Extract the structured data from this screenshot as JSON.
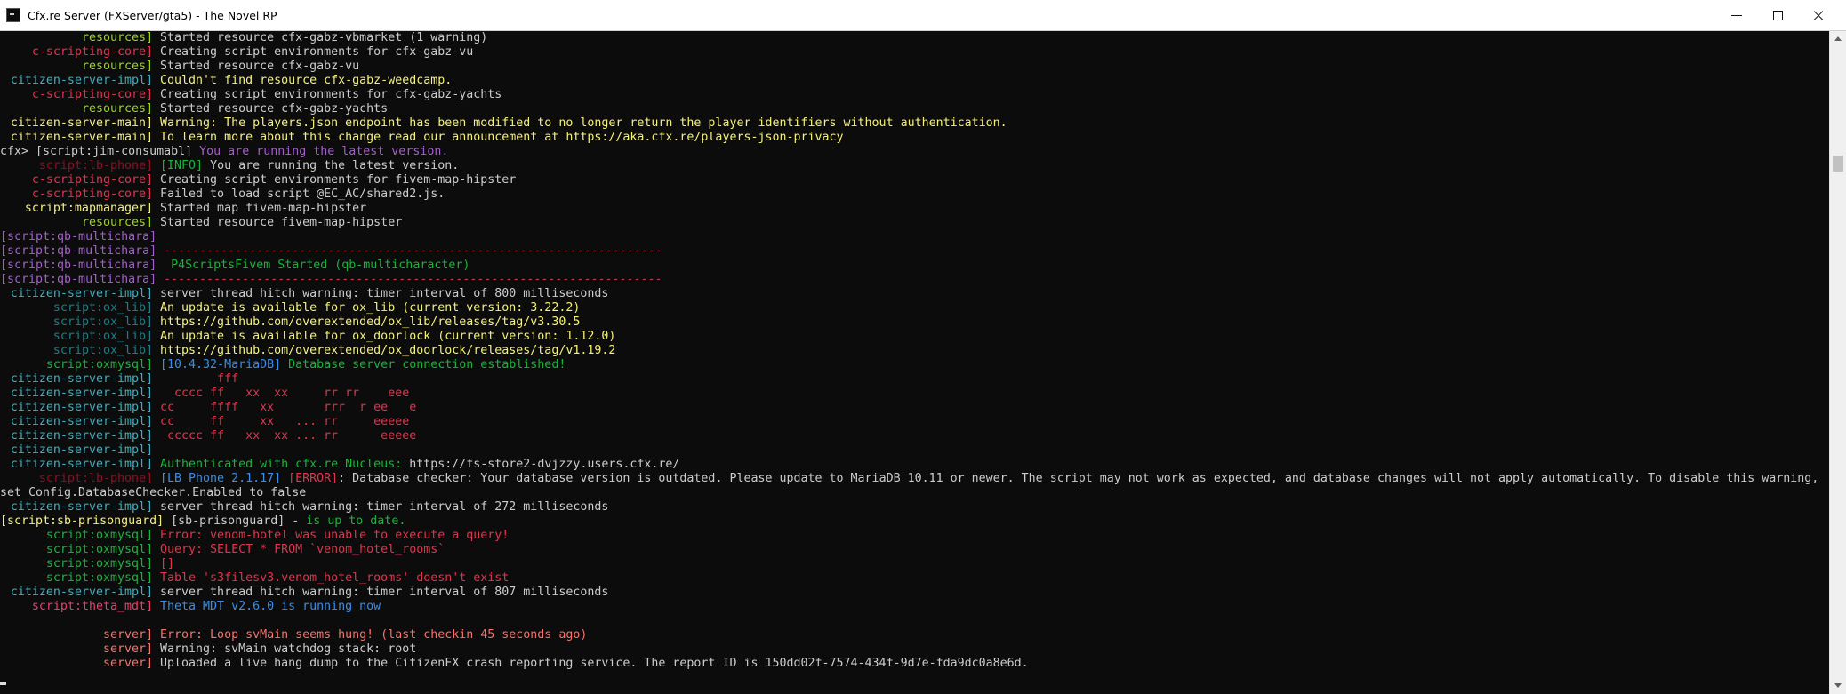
{
  "window": {
    "title": "Cfx.re Server (FXServer/gta5) - The Novel RP"
  },
  "icons": {
    "app": "cfx-server-icon",
    "minimize": "minimize-icon",
    "maximize": "maximize-icon",
    "close": "close-icon"
  },
  "colors": {
    "background": "#0c0c0c",
    "default_text": "#cccccc",
    "lime": "#9dd51b",
    "red": "#e0334e",
    "teal": "#3ab0c0",
    "yellow": "#f5f17a",
    "purple": "#a45fcc",
    "maroon": "#8d1024",
    "green": "#19b43a",
    "blue": "#3a8ee6",
    "dark_teal": "#197f8a",
    "salmon": "#f5736c",
    "pink": "#ef3c70"
  },
  "console": {
    "lines": [
      {
        "src": "resources]",
        "src_color": "lime",
        "segments": [
          {
            "text": "Started resource cfx-gabz-vbmarket (1 warning)",
            "color": "white"
          }
        ]
      },
      {
        "src": "c-scripting-core]",
        "src_color": "red",
        "segments": [
          {
            "text": "Creating script environments for cfx-gabz-vu",
            "color": "white"
          }
        ]
      },
      {
        "src": "resources]",
        "src_color": "lime",
        "segments": [
          {
            "text": "Started resource cfx-gabz-vu",
            "color": "white"
          }
        ]
      },
      {
        "src": "citizen-server-impl]",
        "src_color": "teal",
        "segments": [
          {
            "text": "Couldn't find resource cfx-gabz-weedcamp.",
            "color": "yellow"
          }
        ]
      },
      {
        "src": "c-scripting-core]",
        "src_color": "red",
        "segments": [
          {
            "text": "Creating script environments for cfx-gabz-yachts",
            "color": "white"
          }
        ]
      },
      {
        "src": "resources]",
        "src_color": "lime",
        "segments": [
          {
            "text": "Started resource cfx-gabz-yachts",
            "color": "white"
          }
        ]
      },
      {
        "src": "citizen-server-main]",
        "src_color": "yellow",
        "segments": [
          {
            "text": "Warning: The players.json endpoint has been modified to no longer return the player identifiers without authentication.",
            "color": "yellow"
          }
        ]
      },
      {
        "src": "citizen-server-main]",
        "src_color": "yellow",
        "segments": [
          {
            "text": "To learn more about this change read our announcement at https://aka.cfx.re/players-json-privacy",
            "color": "yellow"
          }
        ]
      },
      {
        "raw": true,
        "segments": [
          {
            "text": "cfx> [script:jim-consumabl] ",
            "color": "white"
          },
          {
            "text": "You are running the latest version.",
            "color": "purple"
          }
        ]
      },
      {
        "src": "script:lb-phone]",
        "src_color": "maroon",
        "segments": [
          {
            "text": "[INFO]",
            "color": "green"
          },
          {
            "text": " You are running the latest version.",
            "color": "white"
          }
        ]
      },
      {
        "src": "c-scripting-core]",
        "src_color": "red",
        "segments": [
          {
            "text": "Creating script environments for fivem-map-hipster",
            "color": "white"
          }
        ]
      },
      {
        "src": "c-scripting-core]",
        "src_color": "red",
        "segments": [
          {
            "text": "Failed to load script @EC_AC/shared2.js.",
            "color": "white"
          }
        ]
      },
      {
        "src": "script:mapmanager]",
        "src_color": "yellow",
        "segments": [
          {
            "text": "Started map fivem-map-hipster",
            "color": "white"
          }
        ]
      },
      {
        "src": "resources]",
        "src_color": "lime",
        "segments": [
          {
            "text": "Started resource fivem-map-hipster",
            "color": "white"
          }
        ]
      },
      {
        "raw": true,
        "segments": [
          {
            "text": "[script:qb-multichara]",
            "color": "purple"
          }
        ]
      },
      {
        "raw": true,
        "segments": [
          {
            "text": "[script:qb-multichara] ",
            "color": "purple"
          },
          {
            "text": "----------------------------------------------------------------------",
            "color": "red"
          }
        ]
      },
      {
        "raw": true,
        "segments": [
          {
            "text": "[script:qb-multichara] ",
            "color": "purple"
          },
          {
            "text": " P4ScriptsFivem Started (qb-multicharacter)",
            "color": "green"
          }
        ]
      },
      {
        "raw": true,
        "segments": [
          {
            "text": "[script:qb-multichara] ",
            "color": "purple"
          },
          {
            "text": "----------------------------------------------------------------------",
            "color": "red"
          }
        ]
      },
      {
        "src": "citizen-server-impl]",
        "src_color": "teal",
        "segments": [
          {
            "text": "server thread hitch warning: timer interval of 800 milliseconds",
            "color": "white"
          }
        ]
      },
      {
        "src": "script:ox_lib]",
        "src_color": "dark_teal",
        "segments": [
          {
            "text": "An update is available for ox_lib (current version: 3.22.2)",
            "color": "yellow"
          }
        ]
      },
      {
        "src": "script:ox_lib]",
        "src_color": "dark_teal",
        "segments": [
          {
            "text": "https://github.com/overextended/ox_lib/releases/tag/v3.30.5",
            "color": "yellow"
          }
        ]
      },
      {
        "src": "script:ox_lib]",
        "src_color": "dark_teal",
        "segments": [
          {
            "text": "An update is available for ox_doorlock (current version: 1.12.0)",
            "color": "yellow"
          }
        ]
      },
      {
        "src": "script:ox_lib]",
        "src_color": "dark_teal",
        "segments": [
          {
            "text": "https://github.com/overextended/ox_doorlock/releases/tag/v1.19.2",
            "color": "yellow"
          }
        ]
      },
      {
        "src": "script:oxmysql]",
        "src_color": "green",
        "segments": [
          {
            "text": "[10.4.32-MariaDB]",
            "color": "blue"
          },
          {
            "text": " Database server connection established!",
            "color": "green"
          }
        ]
      },
      {
        "src": "citizen-server-impl]",
        "src_color": "teal",
        "segments": [
          {
            "text": "        fff",
            "color": "red"
          }
        ]
      },
      {
        "src": "citizen-server-impl]",
        "src_color": "teal",
        "segments": [
          {
            "text": "  cccc ff   xx  xx     rr rr    eee",
            "color": "red"
          }
        ]
      },
      {
        "src": "citizen-server-impl]",
        "src_color": "teal",
        "segments": [
          {
            "text": "cc     ffff   xx       rrr  r ee   e",
            "color": "red"
          }
        ]
      },
      {
        "src": "citizen-server-impl]",
        "src_color": "teal",
        "segments": [
          {
            "text": "cc     ff     xx   ... rr     eeeee",
            "color": "red"
          }
        ]
      },
      {
        "src": "citizen-server-impl]",
        "src_color": "teal",
        "segments": [
          {
            "text": " ccccc ff   xx  xx ... rr      eeeee",
            "color": "red"
          }
        ]
      },
      {
        "src": "citizen-server-impl]",
        "src_color": "teal",
        "segments": []
      },
      {
        "src": "citizen-server-impl]",
        "src_color": "teal",
        "segments": [
          {
            "text": "Authenticated with cfx.re Nucleus: ",
            "color": "green"
          },
          {
            "text": "https://fs-store2-dvjzzy.users.cfx.re/",
            "color": "white"
          }
        ]
      },
      {
        "src": "script:lb-phone]",
        "src_color": "maroon",
        "segments": [
          {
            "text": "[LB Phone 2.1.17]",
            "color": "blue"
          },
          {
            "text": " [ERROR]",
            "color": "red"
          },
          {
            "text": ": Database checker: Your database version is outdated. Please update to MariaDB 10.11 or newer. The script may not work as expected, and database changes will not apply automatically. To disable this warning,",
            "color": "white"
          }
        ]
      },
      {
        "raw": true,
        "segments": [
          {
            "text": "set Config.DatabaseChecker.Enabled to false",
            "color": "white"
          }
        ]
      },
      {
        "src": "citizen-server-impl]",
        "src_color": "teal",
        "segments": [
          {
            "text": "server thread hitch warning: timer interval of 272 milliseconds",
            "color": "white"
          }
        ]
      },
      {
        "raw": true,
        "segments": [
          {
            "text": "[script:sb-prisonguard] ",
            "color": "yellow"
          },
          {
            "text": "[sb-prisonguard] - ",
            "color": "white"
          },
          {
            "text": "is up to date.",
            "color": "green"
          }
        ]
      },
      {
        "src": "script:oxmysql]",
        "src_color": "green",
        "segments": [
          {
            "text": "Error: venom-hotel was unable to execute a query!",
            "color": "red"
          }
        ]
      },
      {
        "src": "script:oxmysql]",
        "src_color": "green",
        "segments": [
          {
            "text": "Query: SELECT * FROM `venom_hotel_rooms`",
            "color": "red"
          }
        ]
      },
      {
        "src": "script:oxmysql]",
        "src_color": "green",
        "segments": [
          {
            "text": "[]",
            "color": "red"
          }
        ]
      },
      {
        "src": "script:oxmysql]",
        "src_color": "green",
        "segments": [
          {
            "text": "Table 's3filesv3.venom_hotel_rooms' doesn't exist",
            "color": "red"
          }
        ]
      },
      {
        "src": "citizen-server-impl]",
        "src_color": "teal",
        "segments": [
          {
            "text": "server thread hitch warning: timer interval of 807 milliseconds",
            "color": "white"
          }
        ]
      },
      {
        "src": "script:theta_mdt]",
        "src_color": "pink",
        "segments": [
          {
            "text": "Theta MDT v2.6.0 is running now",
            "color": "blue"
          }
        ]
      },
      {
        "blank": true,
        "segments": []
      },
      {
        "src": "server]",
        "src_color": "salmon",
        "segments": [
          {
            "text": "Error: Loop svMain seems hung! (last checkin 45 seconds ago)",
            "color": "salmon"
          }
        ]
      },
      {
        "src": "server]",
        "src_color": "salmon",
        "segments": [
          {
            "text": "Warning: svMain watchdog stack: root",
            "color": "white"
          }
        ]
      },
      {
        "src": "server]",
        "src_color": "salmon",
        "segments": [
          {
            "text": "Uploaded a live hang dump to the CitizenFX crash reporting service. The report ID is 150dd02f-7574-434f-9d7e-fda9dc0a8e6d.",
            "color": "white"
          }
        ]
      }
    ]
  }
}
